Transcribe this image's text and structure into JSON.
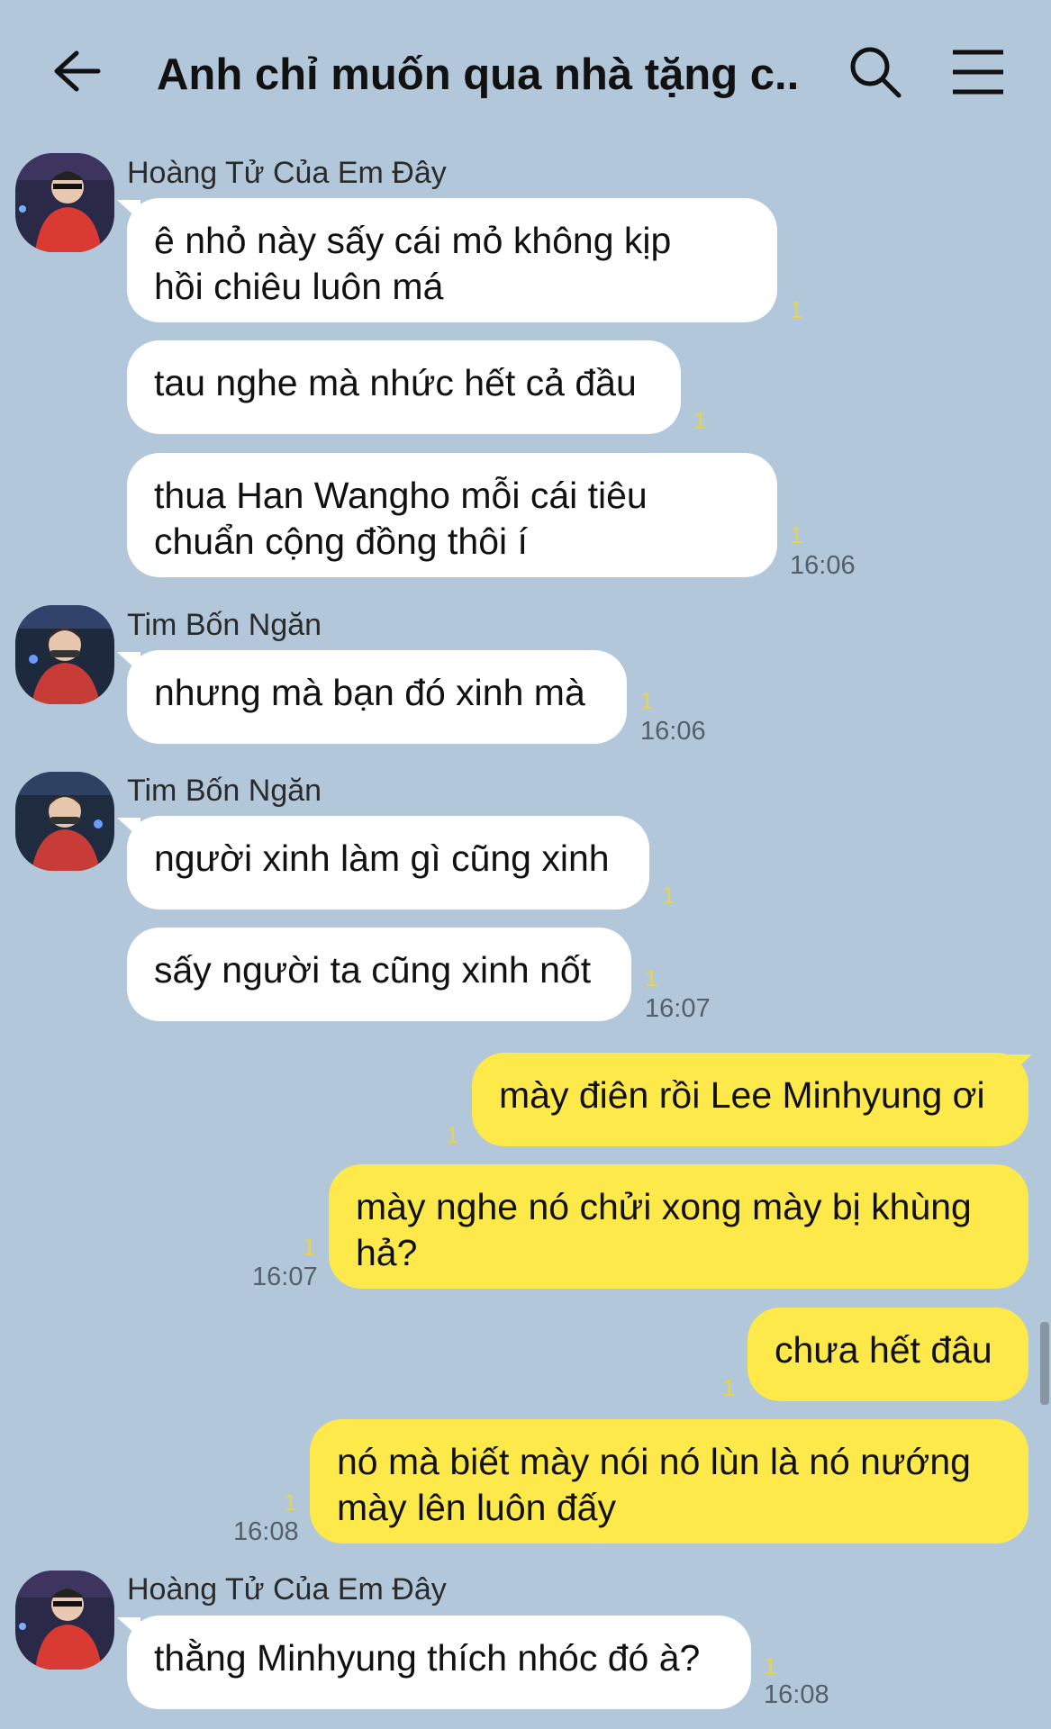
{
  "header": {
    "title": "Anh chỉ muốn qua nhà tặng c...",
    "back_icon": "arrow-left-icon",
    "search_icon": "search-icon",
    "menu_icon": "hamburger-menu-icon"
  },
  "colors": {
    "background": "#b2c7da",
    "incoming_bubble": "#ffffff",
    "outgoing_bubble": "#fee94b",
    "unread_count": "#e8d44a"
  },
  "groups": [
    {
      "sender": "Hoàng Tử Của Em Đây",
      "messages": [
        {
          "text_line1": "ê nhỏ này sấy cái mỏ không kịp",
          "text_line2": "hồi chiêu luôn má",
          "unread": "1"
        },
        {
          "text": "tau nghe mà nhức hết cả đầu",
          "unread": "1"
        },
        {
          "text_line1": "thua Han Wangho mỗi cái tiêu",
          "text_line2": "chuẩn cộng đồng thôi í",
          "unread": "1",
          "time": "16:06"
        }
      ]
    },
    {
      "sender": "Tim Bốn Ngăn",
      "messages": [
        {
          "text": "nhưng mà bạn đó xinh mà",
          "unread": "1",
          "time": "16:06"
        }
      ]
    },
    {
      "sender": "Tim Bốn Ngăn",
      "messages": [
        {
          "text": "người xinh làm gì cũng xinh",
          "unread": "1"
        },
        {
          "text": "sấy người ta cũng xinh nốt",
          "unread": "1",
          "time": "16:07"
        }
      ]
    },
    {
      "sender": "me",
      "messages": [
        {
          "text": "mày điên rồi Lee Minhyung ơi",
          "unread": "1"
        },
        {
          "text_line1": "mày nghe nó chửi xong mày bị khùng",
          "text_line2": "hả?",
          "unread": "1",
          "time": "16:07"
        },
        {
          "text": "chưa hết đâu",
          "unread": "1"
        },
        {
          "text_line1": "nó mà biết mày nói nó lùn là nó nướng",
          "text_line2": "mày lên luôn đấy",
          "unread": "1",
          "time": "16:08"
        }
      ]
    },
    {
      "sender": "Hoàng Tử Của Em Đây",
      "messages": [
        {
          "text": "thằng Minhyung thích nhóc đó à?",
          "unread": "1",
          "time": "16:08"
        }
      ]
    }
  ]
}
